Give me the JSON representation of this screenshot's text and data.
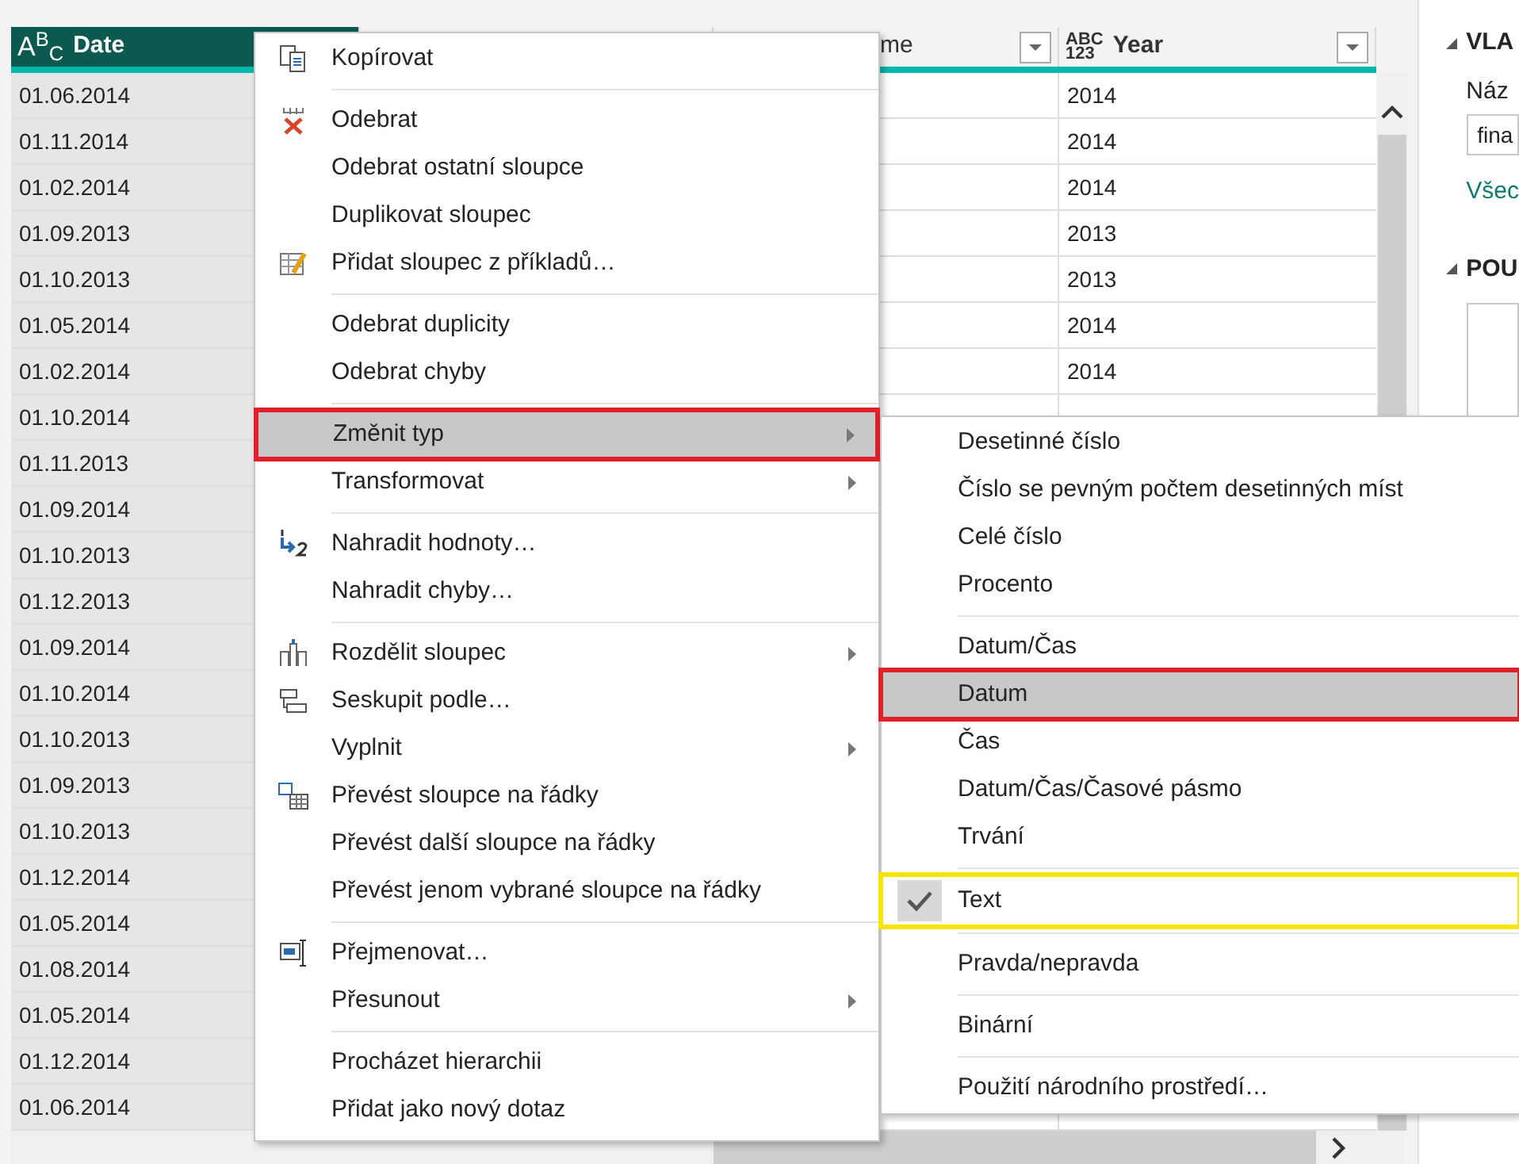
{
  "table": {
    "columns": [
      {
        "label": "Date",
        "type_label": [
          "A$^{B}$$_{C}$"
        ],
        "selected": true,
        "filter": false
      },
      {
        "selected": false
      },
      {
        "label": "me",
        "selected": false,
        "filter": true
      },
      {
        "label": "Year",
        "type_label": [
          "ABC",
          "123"
        ],
        "selected": false,
        "filter": true
      }
    ],
    "rows": [
      {
        "date": "01.06.2014",
        "year": "2014"
      },
      {
        "date": "01.11.2014",
        "year": "2014"
      },
      {
        "date": "01.02.2014",
        "year": "2014"
      },
      {
        "date": "01.09.2013",
        "year": "2013"
      },
      {
        "date": "01.10.2013",
        "year": "2013"
      },
      {
        "date": "01.05.2014",
        "year": "2014"
      },
      {
        "date": "01.02.2014",
        "year": "2014"
      },
      {
        "date": "01.10.2014"
      },
      {
        "date": "01.11.2013"
      },
      {
        "date": "01.09.2014"
      },
      {
        "date": "01.10.2013"
      },
      {
        "date": "01.12.2013"
      },
      {
        "date": "01.09.2014"
      },
      {
        "date": "01.10.2014"
      },
      {
        "date": "01.10.2013"
      },
      {
        "date": "01.09.2013"
      },
      {
        "date": "01.10.2013"
      },
      {
        "date": "01.12.2014"
      },
      {
        "date": "01.05.2014"
      },
      {
        "date": "01.08.2014"
      },
      {
        "date": "01.05.2014"
      },
      {
        "date": "01.12.2014"
      },
      {
        "date": "01.06.2014"
      }
    ]
  },
  "side_panel": {
    "section_1": "VLA",
    "name_label": "Náz",
    "name_value": "fina",
    "link": "Všec",
    "section_2": "POU"
  },
  "context_menu": {
    "groups": [
      [
        {
          "label": "Kopírovat",
          "kind": "copy",
          "submenu": false,
          "selected": false
        }
      ],
      [
        {
          "label": "Odebrat",
          "kind": "remove",
          "submenu": false,
          "selected": false
        },
        {
          "label": "Odebrat ostatní sloupce",
          "kind": "plain",
          "submenu": false,
          "selected": false
        },
        {
          "label": "Duplikovat sloupec",
          "kind": "plain",
          "submenu": false,
          "selected": false
        },
        {
          "label": "Přidat sloupec z příkladů…",
          "kind": "examples",
          "submenu": false,
          "selected": false
        }
      ],
      [
        {
          "label": "Odebrat duplicity",
          "kind": "plain",
          "submenu": false,
          "selected": false
        },
        {
          "label": "Odebrat chyby",
          "kind": "plain",
          "submenu": false,
          "selected": false
        }
      ],
      [
        {
          "label": "Změnit typ",
          "kind": "plain",
          "submenu": true,
          "selected": true
        },
        {
          "label": "Transformovat",
          "kind": "plain",
          "submenu": true,
          "selected": false
        }
      ],
      [
        {
          "label": "Nahradit hodnoty…",
          "kind": "replace",
          "submenu": false,
          "selected": false
        },
        {
          "label": "Nahradit chyby…",
          "kind": "plain",
          "submenu": false,
          "selected": false
        }
      ],
      [
        {
          "label": "Rozdělit sloupec",
          "kind": "split",
          "submenu": true,
          "selected": false
        },
        {
          "label": "Seskupit podle…",
          "kind": "group",
          "submenu": false,
          "selected": false
        },
        {
          "label": "Vyplnit",
          "kind": "plain",
          "submenu": true,
          "selected": false
        },
        {
          "label": "Převést sloupce na řádky",
          "kind": "unpivot",
          "submenu": false,
          "selected": false
        },
        {
          "label": "Převést další sloupce na řádky",
          "kind": "plain",
          "submenu": false,
          "selected": false
        },
        {
          "label": "Převést jenom vybrané sloupce na řádky",
          "kind": "plain",
          "submenu": false,
          "selected": false
        }
      ],
      [
        {
          "label": "Přejmenovat…",
          "kind": "rename",
          "submenu": false,
          "selected": false
        },
        {
          "label": "Přesunout",
          "kind": "plain",
          "submenu": true,
          "selected": false
        }
      ],
      [
        {
          "label": "Procházet hierarchii",
          "kind": "plain",
          "submenu": false,
          "selected": false
        },
        {
          "label": "Přidat jako nový dotaz",
          "kind": "plain",
          "submenu": false,
          "selected": false
        }
      ]
    ]
  },
  "type_submenu": {
    "groups": [
      [
        {
          "label": "Desetinné číslo",
          "selected": false,
          "checked": false
        },
        {
          "label": "Číslo se pevným počtem desetinných míst",
          "selected": false,
          "checked": false
        },
        {
          "label": "Celé číslo",
          "selected": false,
          "checked": false
        },
        {
          "label": "Procento",
          "selected": false,
          "checked": false
        }
      ],
      [
        {
          "label": "Datum/Čas",
          "selected": false,
          "checked": false
        },
        {
          "label": "Datum",
          "selected": true,
          "checked": false
        },
        {
          "label": "Čas",
          "selected": false,
          "checked": false
        },
        {
          "label": "Datum/Čas/Časové pásmo",
          "selected": false,
          "checked": false
        },
        {
          "label": "Trvání",
          "selected": false,
          "checked": false
        }
      ],
      [
        {
          "label": "Text",
          "selected": false,
          "checked": true
        }
      ],
      [
        {
          "label": "Pravda/nepravda",
          "selected": false,
          "checked": false
        }
      ],
      [
        {
          "label": "Binární",
          "selected": false,
          "checked": false
        }
      ],
      [
        {
          "label": "Použití národního prostředí…",
          "selected": false,
          "checked": false
        }
      ]
    ]
  }
}
